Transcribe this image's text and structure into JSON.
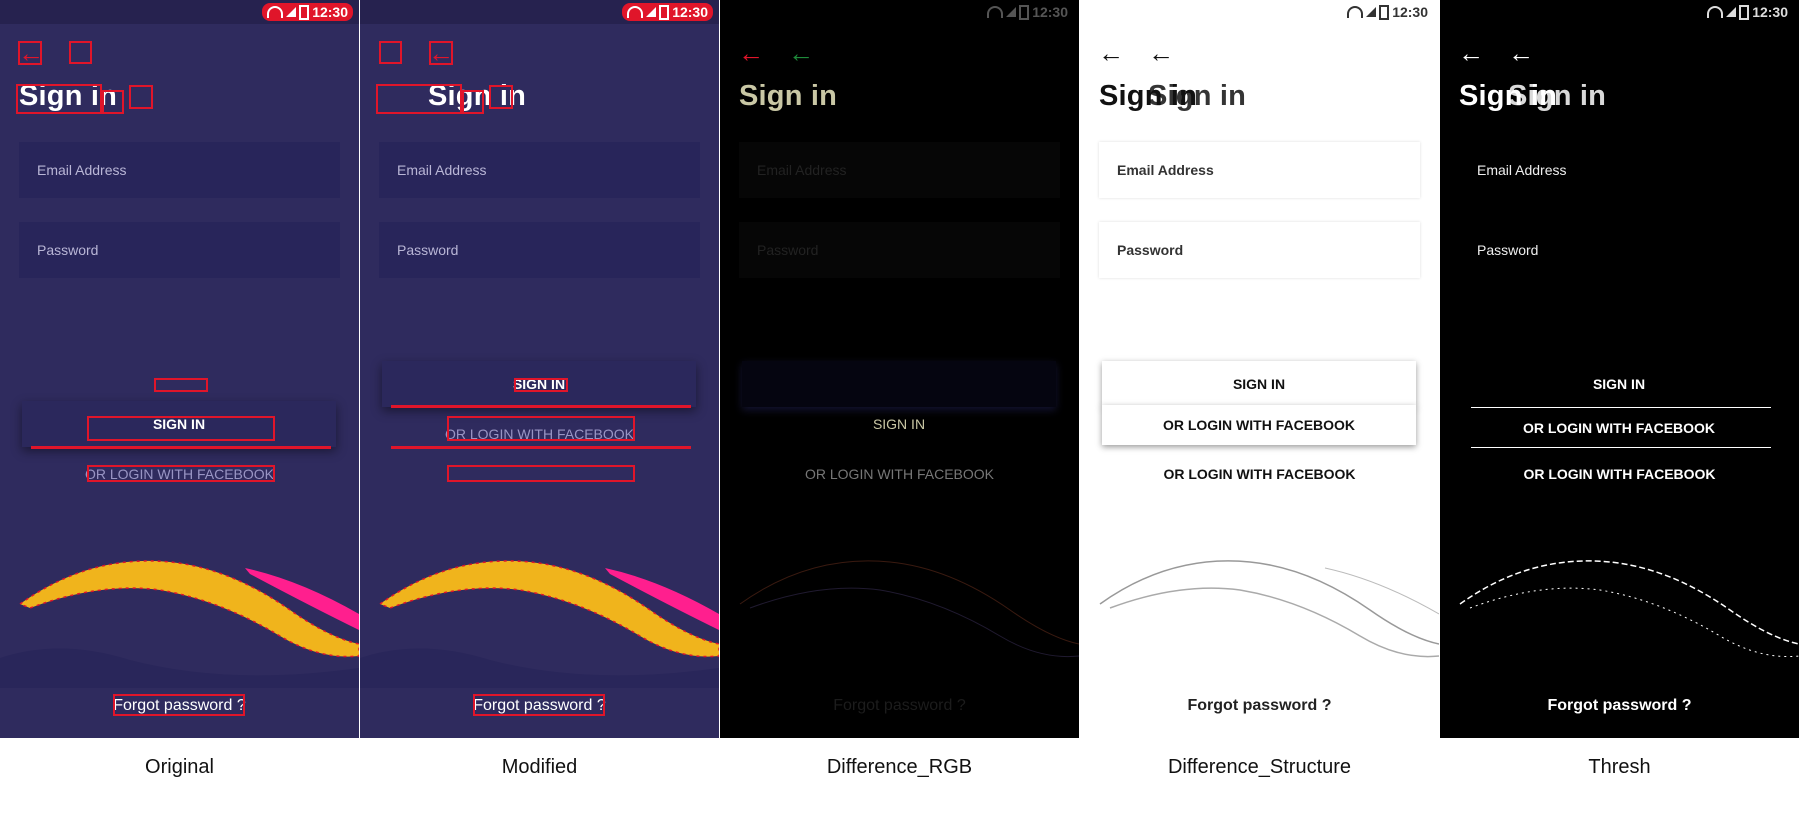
{
  "status": {
    "time": "12:30"
  },
  "screen": {
    "title": "Sign in",
    "email_label": "Email Address",
    "password_label": "Password",
    "signin_label": "SIGN IN",
    "facebook_label": "OR LOGIN WITH FACEBOOK",
    "forgot_label": "Forgot password ?"
  },
  "captions": [
    "Original",
    "Modified",
    "Difference_RGB",
    "Difference_Structure",
    "Thresh"
  ],
  "colors": {
    "app_bg": "#2f2b5e",
    "field_bg": "#28255a",
    "highlight": "#e0152a",
    "wave_yellow": "#f0b41c",
    "wave_pink": "#ff1f8e"
  },
  "icons": [
    "back-arrow-icon",
    "wifi-icon",
    "signal-icon",
    "battery-icon"
  ]
}
